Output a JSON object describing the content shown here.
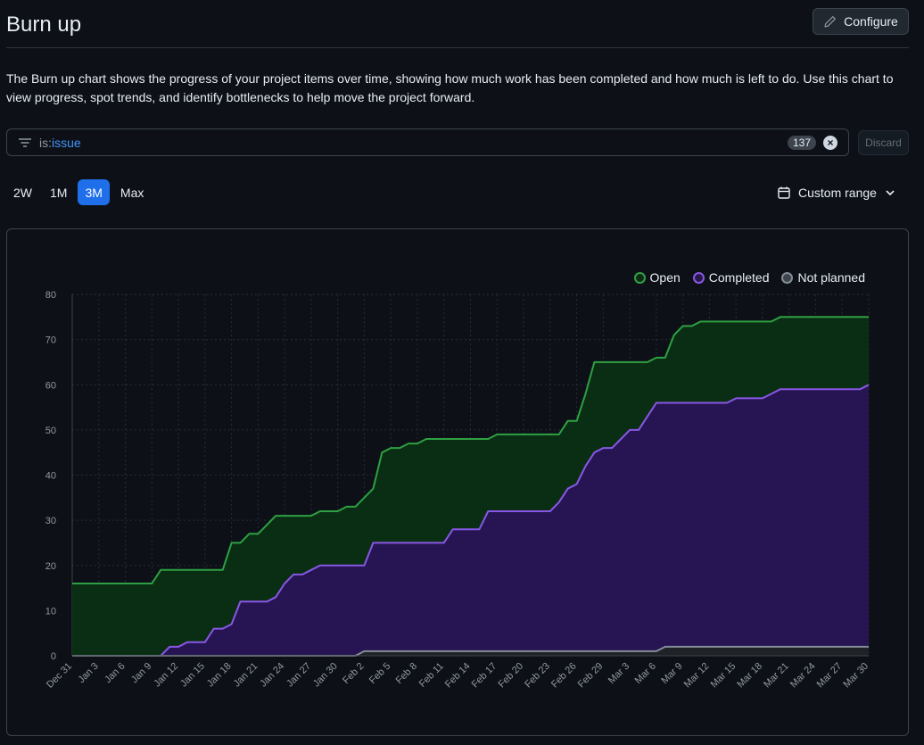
{
  "header": {
    "title": "Burn up",
    "configure_label": "Configure"
  },
  "description": "The Burn up chart shows the progress of your project items over time, showing how much work has been completed and how much is left to do. Use this chart to view progress, spot trends, and identify bottlenecks to help move the project forward.",
  "filter": {
    "key": "is:",
    "value": "issue",
    "count": "137",
    "discard_label": "Discard"
  },
  "ranges": [
    {
      "label": "2W",
      "active": false
    },
    {
      "label": "1M",
      "active": false
    },
    {
      "label": "3M",
      "active": true
    },
    {
      "label": "Max",
      "active": false
    }
  ],
  "custom_range_label": "Custom range",
  "icons": {
    "configure": "pencil-icon",
    "filter": "filter-icon",
    "clear": "x-circle-icon",
    "calendar": "calendar-icon",
    "chevron": "chevron-down-icon"
  },
  "colors": {
    "open": "#2ea043",
    "completed": "#8957e5",
    "not_planned": "#848d97",
    "accent": "#1f6feb"
  },
  "chart_data": {
    "type": "area",
    "ylim": [
      0,
      80
    ],
    "yticks": [
      0,
      10,
      20,
      30,
      40,
      50,
      60,
      70,
      80
    ],
    "xticks": [
      "Dec 31",
      "Jan 3",
      "Jan 6",
      "Jan 9",
      "Jan 12",
      "Jan 15",
      "Jan 18",
      "Jan 21",
      "Jan 24",
      "Jan 27",
      "Jan 30",
      "Feb 2",
      "Feb 5",
      "Feb 8",
      "Feb 11",
      "Feb 14",
      "Feb 17",
      "Feb 20",
      "Feb 23",
      "Feb 26",
      "Feb 29",
      "Mar 3",
      "Mar 6",
      "Mar 9",
      "Mar 12",
      "Mar 15",
      "Mar 18",
      "Mar 21",
      "Mar 24",
      "Mar 27",
      "Mar 30"
    ],
    "legend": "top-right",
    "grid": true,
    "x_start": "Dec 31",
    "series": [
      {
        "name": "Open",
        "color": "#2ea043",
        "values": [
          16,
          16,
          16,
          16,
          16,
          16,
          16,
          16,
          16,
          16,
          19,
          19,
          19,
          19,
          19,
          19,
          19,
          19,
          25,
          25,
          27,
          27,
          29,
          31,
          31,
          31,
          31,
          31,
          32,
          32,
          32,
          33,
          33,
          35,
          37,
          45,
          46,
          46,
          47,
          47,
          48,
          48,
          48,
          48,
          48,
          48,
          48,
          48,
          49,
          49,
          49,
          49,
          49,
          49,
          49,
          49,
          52,
          52,
          58,
          65,
          65,
          65,
          65,
          65,
          65,
          65,
          66,
          66,
          71,
          73,
          73,
          74,
          74,
          74,
          74,
          74,
          74,
          74,
          74,
          74,
          75,
          75,
          75,
          75,
          75,
          75,
          75,
          75,
          75,
          75,
          75
        ]
      },
      {
        "name": "Completed",
        "color": "#8957e5",
        "values": [
          0,
          0,
          0,
          0,
          0,
          0,
          0,
          0,
          0,
          0,
          0,
          2,
          2,
          3,
          3,
          3,
          6,
          6,
          7,
          12,
          12,
          12,
          12,
          13,
          16,
          18,
          18,
          19,
          20,
          20,
          20,
          20,
          20,
          20,
          25,
          25,
          25,
          25,
          25,
          25,
          25,
          25,
          25,
          28,
          28,
          28,
          28,
          32,
          32,
          32,
          32,
          32,
          32,
          32,
          32,
          34,
          37,
          38,
          42,
          45,
          46,
          46,
          48,
          50,
          50,
          53,
          56,
          56,
          56,
          56,
          56,
          56,
          56,
          56,
          56,
          57,
          57,
          57,
          57,
          58,
          59,
          59,
          59,
          59,
          59,
          59,
          59,
          59,
          59,
          59,
          60
        ]
      },
      {
        "name": "Not planned",
        "color": "#848d97",
        "values": [
          0,
          0,
          0,
          0,
          0,
          0,
          0,
          0,
          0,
          0,
          0,
          0,
          0,
          0,
          0,
          0,
          0,
          0,
          0,
          0,
          0,
          0,
          0,
          0,
          0,
          0,
          0,
          0,
          0,
          0,
          0,
          0,
          0,
          1,
          1,
          1,
          1,
          1,
          1,
          1,
          1,
          1,
          1,
          1,
          1,
          1,
          1,
          1,
          1,
          1,
          1,
          1,
          1,
          1,
          1,
          1,
          1,
          1,
          1,
          1,
          1,
          1,
          1,
          1,
          1,
          1,
          1,
          2,
          2,
          2,
          2,
          2,
          2,
          2,
          2,
          2,
          2,
          2,
          2,
          2,
          2,
          2,
          2,
          2,
          2,
          2,
          2,
          2,
          2,
          2,
          2
        ]
      }
    ]
  }
}
